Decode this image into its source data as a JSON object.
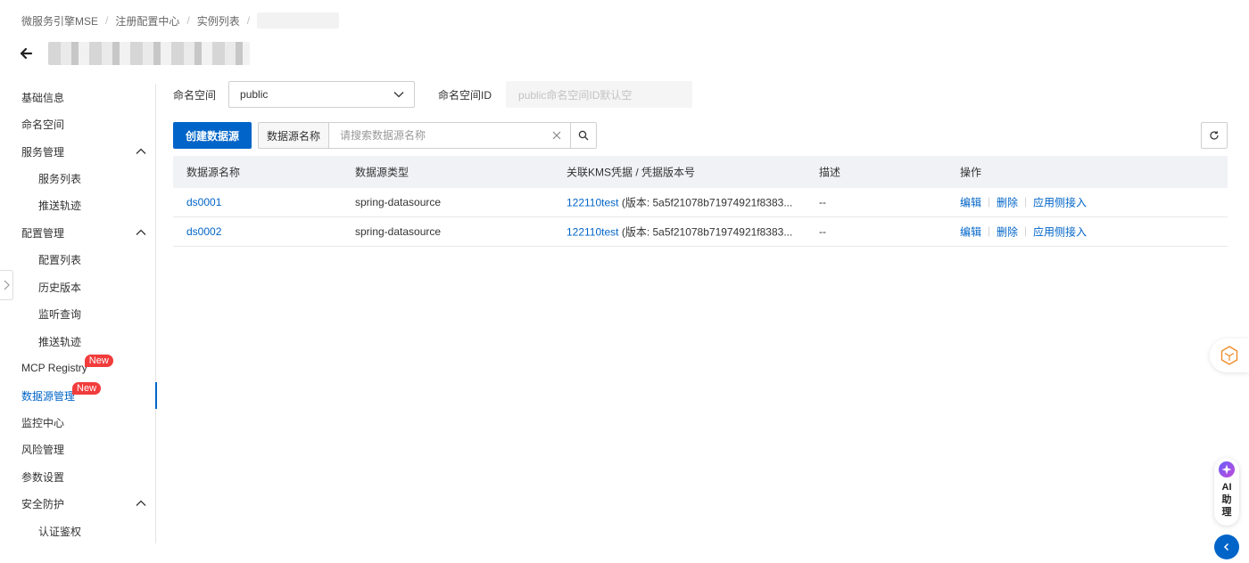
{
  "breadcrumb": [
    "微服务引擎MSE",
    "注册配置中心",
    "实例列表"
  ],
  "sidebar": {
    "items": [
      {
        "label": "基础信息"
      },
      {
        "label": "命名空间"
      },
      {
        "label": "服务管理"
      },
      {
        "label": "服务列表"
      },
      {
        "label": "推送轨迹"
      },
      {
        "label": "配置管理"
      },
      {
        "label": "配置列表"
      },
      {
        "label": "历史版本"
      },
      {
        "label": "监听查询"
      },
      {
        "label": "推送轨迹"
      },
      {
        "label": "MCP Registry",
        "badge": "New"
      },
      {
        "label": "数据源管理",
        "badge": "New"
      },
      {
        "label": "监控中心"
      },
      {
        "label": "风险管理"
      },
      {
        "label": "参数设置"
      },
      {
        "label": "安全防护"
      },
      {
        "label": "认证鉴权"
      }
    ]
  },
  "filters": {
    "namespace_label": "命名空间",
    "namespace_value": "public",
    "namespace_id_label": "命名空间ID",
    "namespace_id_placeholder": "public命名空间ID默认空"
  },
  "toolbar": {
    "create_label": "创建数据源",
    "search_field": "数据源名称",
    "search_placeholder": "请搜索数据源名称"
  },
  "table": {
    "headers": [
      "数据源名称",
      "数据源类型",
      "关联KMS凭据 / 凭据版本号",
      "描述",
      "操作"
    ],
    "rows": [
      {
        "name": "ds0001",
        "type": "spring-datasource",
        "kms": "122110test",
        "version": "(版本: 5a5f21078b71974921f8383...",
        "desc": "--"
      },
      {
        "name": "ds0002",
        "type": "spring-datasource",
        "kms": "122110test",
        "version": "(版本: 5a5f21078b71974921f8383...",
        "desc": "--"
      }
    ],
    "actions": [
      "编辑",
      "删除",
      "应用侧接入"
    ]
  },
  "ai_assistant": {
    "label": "AI助理"
  },
  "colors": {
    "primary": "#0064c8",
    "badge": "#f23c3c",
    "header_bg": "#f0f2f5"
  }
}
